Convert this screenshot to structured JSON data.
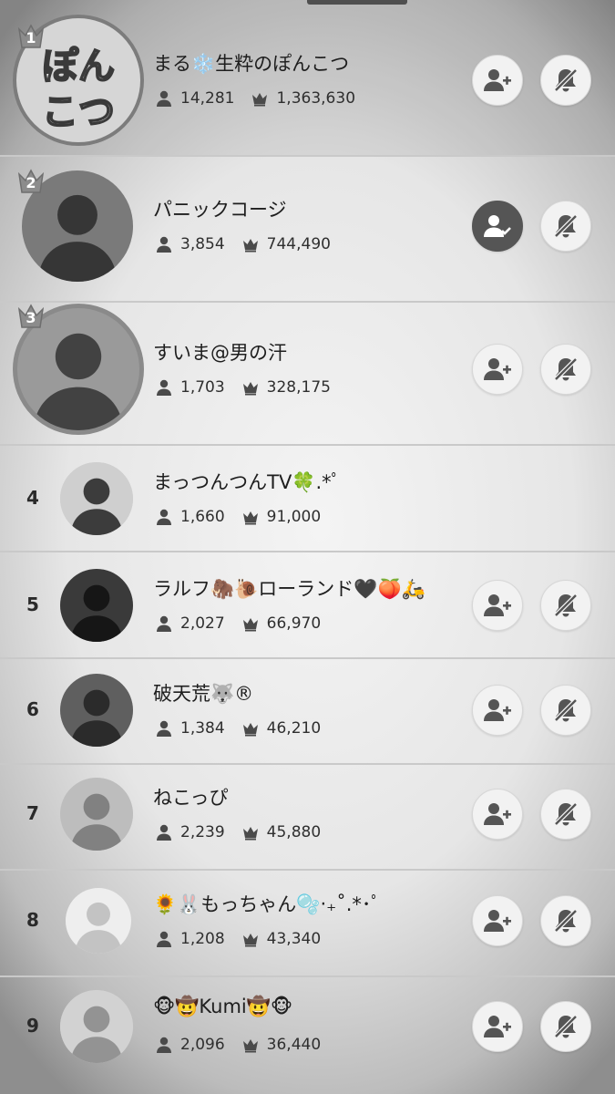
{
  "ranking": [
    {
      "rank": "1",
      "name": "まる❄️生粋のぽんこつ",
      "listeners": "14,281",
      "points": "1,363,630",
      "following": false,
      "avatar_text": [
        "ぽん",
        "こつ"
      ]
    },
    {
      "rank": "2",
      "name": "パニックコージ",
      "listeners": "3,854",
      "points": "744,490",
      "following": true
    },
    {
      "rank": "3",
      "name": "すいま@男の汗",
      "listeners": "1,703",
      "points": "328,175",
      "following": false
    },
    {
      "rank": "4",
      "name": "まっつんつんTV🍀.*ﾟ",
      "listeners": "1,660",
      "points": "91,000",
      "following": null
    },
    {
      "rank": "5",
      "name": "ラルフ🦣🐌ローランド🖤🍑🛵",
      "listeners": "2,027",
      "points": "66,970",
      "following": false
    },
    {
      "rank": "6",
      "name": "破天荒🐺®",
      "listeners": "1,384",
      "points": "46,210",
      "following": false
    },
    {
      "rank": "7",
      "name": "ねこっぴ",
      "listeners": "2,239",
      "points": "45,880",
      "following": false
    },
    {
      "rank": "8",
      "name": "🌻🐰もっちゃん🫧‧₊˚.*･ﾟ",
      "listeners": "1,208",
      "points": "43,340",
      "following": false
    },
    {
      "rank": "9",
      "name": "🐵🤠Kumi🤠🐵",
      "listeners": "2,096",
      "points": "36,440",
      "following": false
    }
  ],
  "icons": {
    "listeners": "person-icon",
    "points": "crown-icon",
    "follow": "add-user-icon",
    "following": "user-check-icon",
    "notify_off": "bell-off-icon",
    "rank_badge": "crown-badge-icon"
  },
  "colors": {
    "background": "#e6e6e6",
    "text": "#1e1e1e",
    "button": "#f2f2f2",
    "button_following": "#555555",
    "icon": "#555555"
  }
}
